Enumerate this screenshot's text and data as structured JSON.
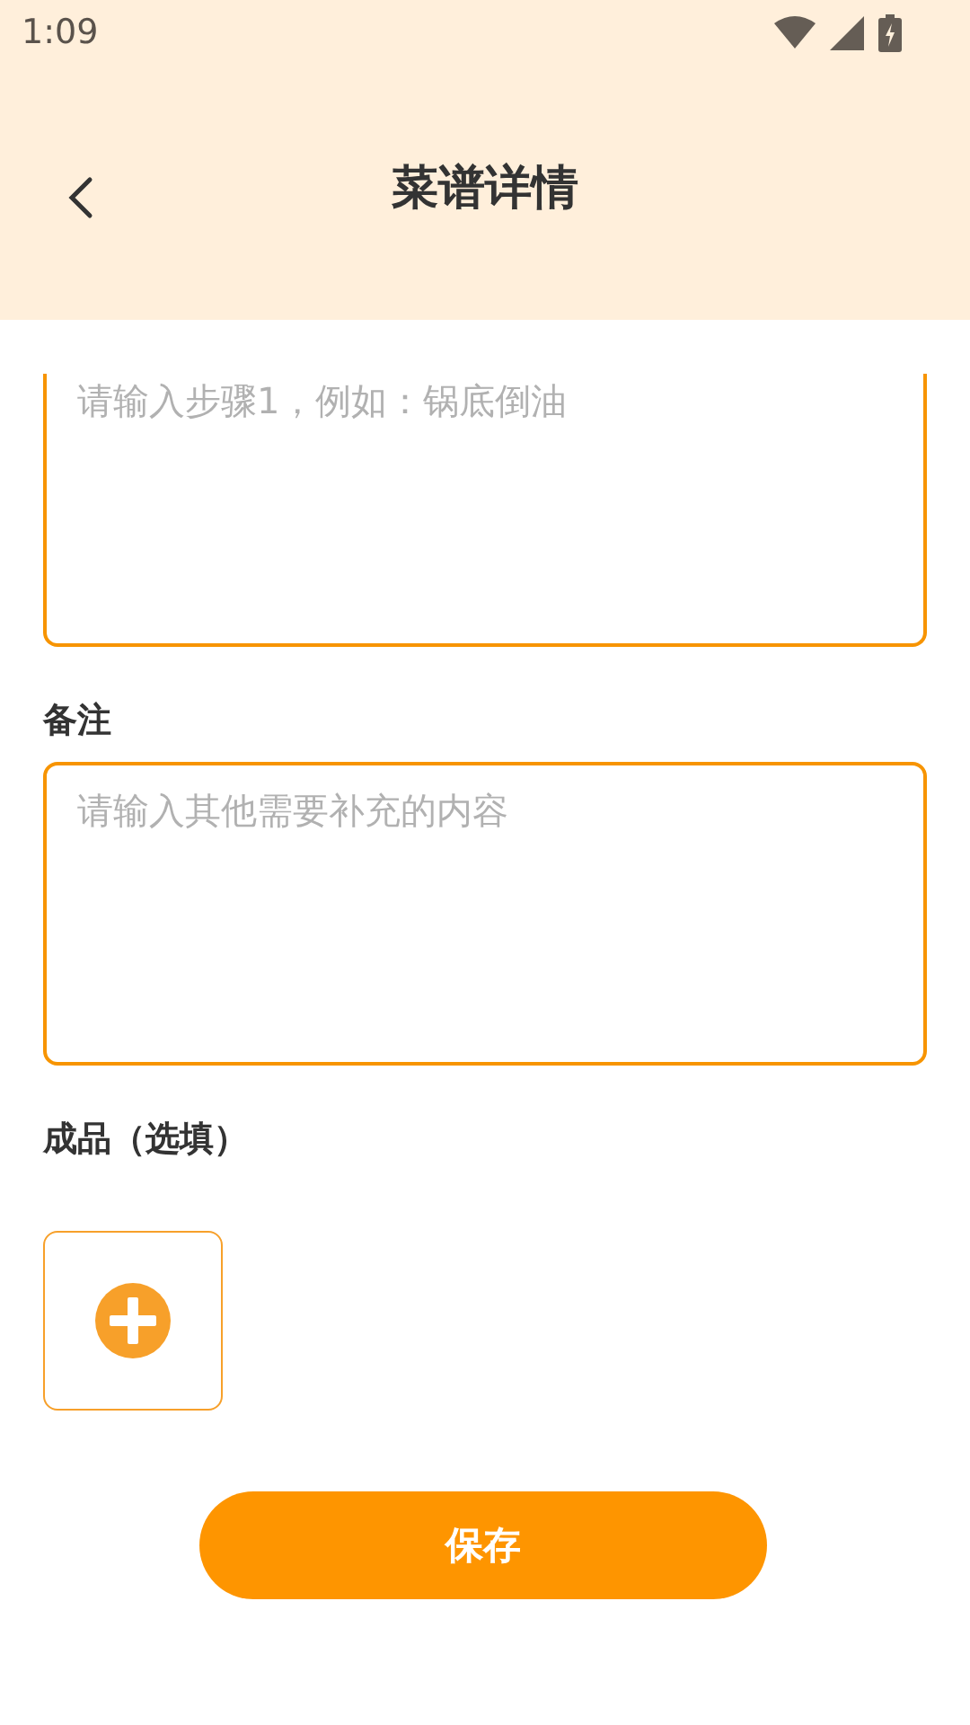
{
  "status_bar": {
    "time": "1:09"
  },
  "header": {
    "title": "菜谱详情"
  },
  "step_field": {
    "placeholder": "请输入步骤1，例如：锅底倒油"
  },
  "notes": {
    "label": "备注",
    "placeholder": "请输入其他需要补充的内容"
  },
  "photo": {
    "label": "成品（选填）"
  },
  "save_button": {
    "label": "保存"
  }
}
